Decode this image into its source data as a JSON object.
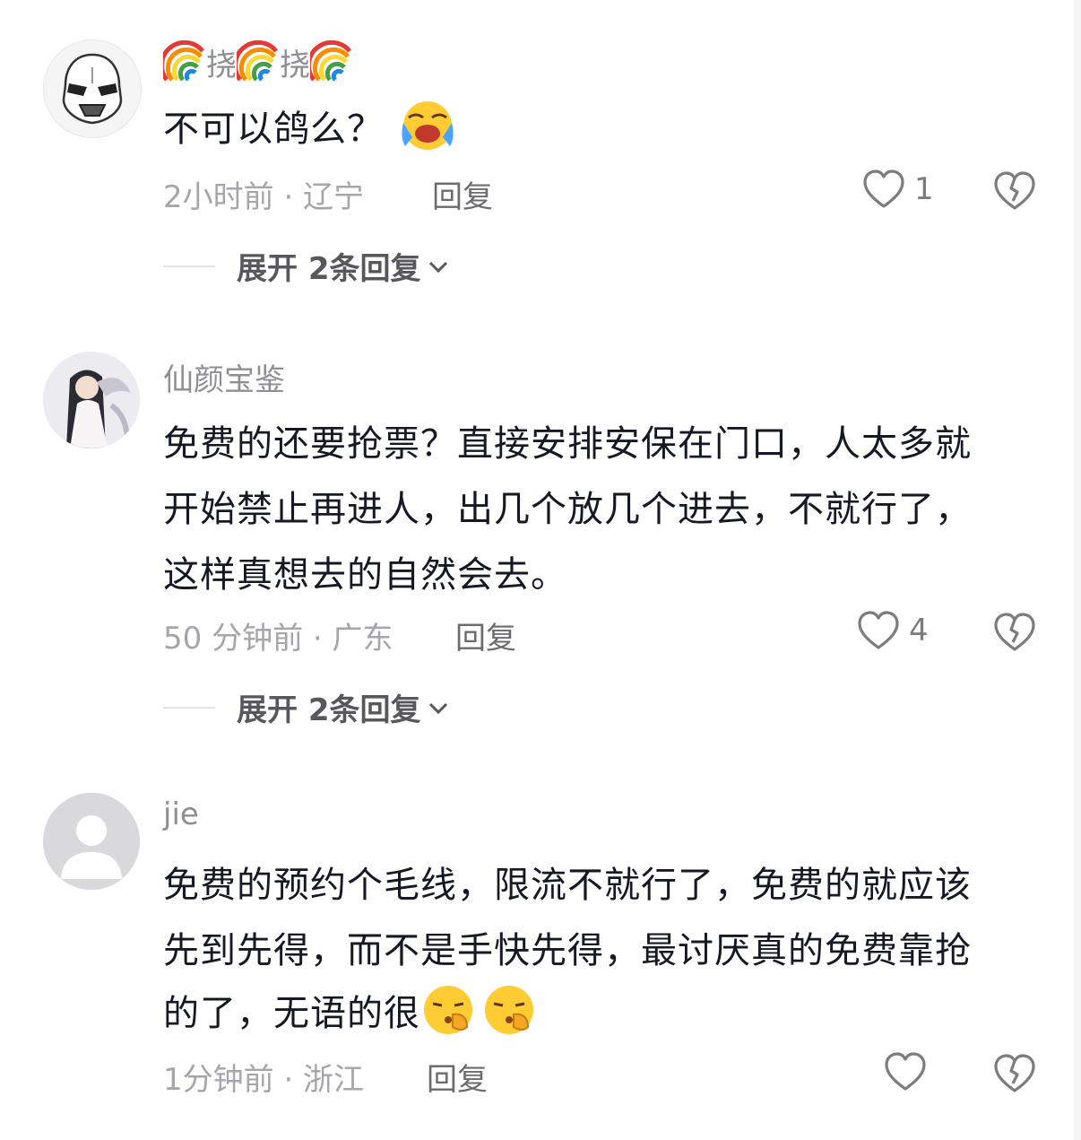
{
  "comments": [
    {
      "username_segments": [
        "挠",
        "挠"
      ],
      "avatar_icon": "stormtrooper-avatar",
      "text_lines": [
        "不可以鸽么？"
      ],
      "emoji": "face-with-tears-icon",
      "time": "2小时前 · 辽宁",
      "reply_label": "回复",
      "like_count": "1",
      "expand_label": "展开 2条回复"
    },
    {
      "username": "仙颜宝鉴",
      "avatar_icon": "anime-character-avatar",
      "text_lines": [
        "免费的还要抢票？直接安排安保在门口，人太多就",
        "开始禁止再进人，出几个放几个进去，不就行了，",
        "这样真想去的自然会去。"
      ],
      "time": "50 分钟前 · 广东",
      "reply_label": "回复",
      "like_count": "4",
      "expand_label": "展开 2条回复"
    },
    {
      "username": "jie",
      "avatar_icon": "default-user-avatar",
      "text_lines": [
        "免费的预约个毛线，限流不就行了，免费的就应该",
        "先到先得，而不是手快先得，最讨厌真的免费靠抢",
        "的了，无语的很"
      ],
      "emoji": "shushing-face-icon",
      "time": "1分钟前 · 浙江",
      "reply_label": "回复",
      "like_count": ""
    }
  ],
  "colors": {
    "text": "#161823",
    "meta": "#a5a5ab",
    "username": "#8e8e93"
  }
}
